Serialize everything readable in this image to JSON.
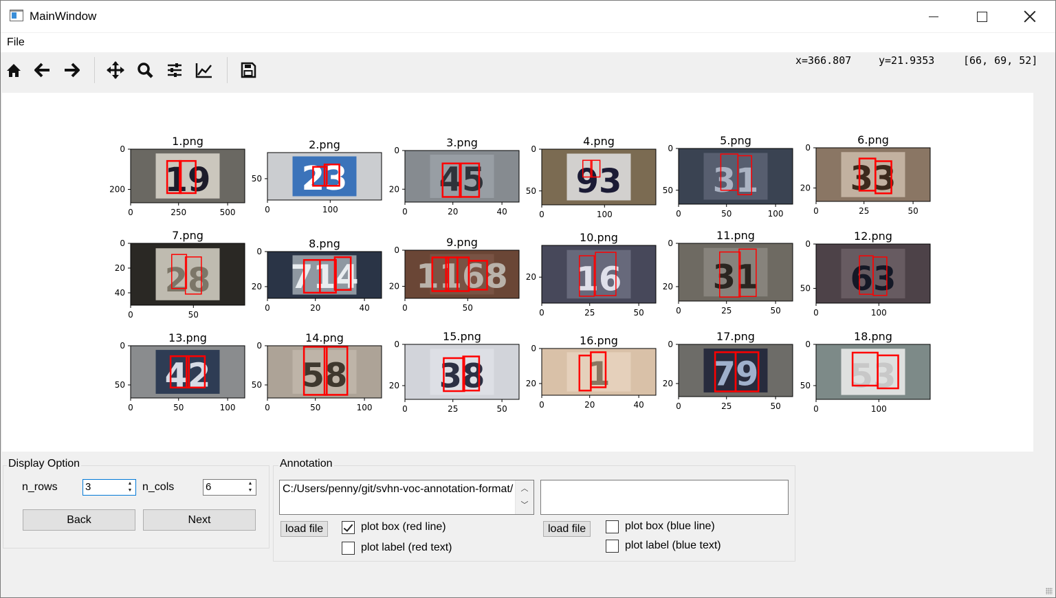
{
  "window": {
    "title": "MainWindow"
  },
  "menu": {
    "file": "File"
  },
  "toolbar": {
    "icons": [
      "home-icon",
      "back-arrow-icon",
      "forward-arrow-icon",
      "pan-icon",
      "zoom-icon",
      "configure-subplots-icon",
      "edit-axis-icon",
      "save-icon"
    ],
    "x": "x=366.807",
    "y": "y=21.9353",
    "pixel": "[66, 69, 52]"
  },
  "figure": {
    "titles": [
      "1.png",
      "2.png",
      "3.png",
      "4.png",
      "5.png",
      "6.png",
      "7.png",
      "8.png",
      "9.png",
      "10.png",
      "11.png",
      "12.png",
      "13.png",
      "14.png",
      "15.png",
      "16.png",
      "17.png",
      "18.png"
    ],
    "images": [
      {
        "digits": "19",
        "bg": "#6a6862",
        "plate": "#d6d2c8",
        "fg": "#1d1c2a"
      },
      {
        "digits": "23",
        "bg": "#cbcdd0",
        "plate": "#2b69b7",
        "fg": "#ffffff"
      },
      {
        "digits": "45",
        "bg": "#868b90",
        "plate": "#9aa0a6",
        "fg": "#2e333a"
      },
      {
        "digits": "93",
        "bg": "#7b6b52",
        "plate": "#dcdcdc",
        "fg": "#1b1b35"
      },
      {
        "digits": "31",
        "bg": "#3a4352",
        "plate": "#5b6272",
        "fg": "#aab2c2"
      },
      {
        "digits": "33",
        "bg": "#8a7664",
        "plate": "#c8b8a6",
        "fg": "#3c2a1c"
      },
      {
        "digits": "28",
        "bg": "#2a2824",
        "plate": "#cfcbc0",
        "fg": "#7c7668"
      },
      {
        "digits": "714",
        "bg": "#2a3446",
        "plate": "#9aa3ab",
        "fg": "#e9edf0"
      },
      {
        "digits": "1168",
        "bg": "#6a4636",
        "plate": "#7b5446",
        "fg": "#b9b2aa"
      },
      {
        "digits": "16",
        "bg": "#47485a",
        "plate": "#6a6d7e",
        "fg": "#dfe0ea"
      },
      {
        "digits": "31",
        "bg": "#6e6a62",
        "plate": "#8a8680",
        "fg": "#2a2620"
      },
      {
        "digits": "63",
        "bg": "#4d4248",
        "plate": "#6a5e64",
        "fg": "#141826"
      },
      {
        "digits": "42",
        "bg": "#8a8c8e",
        "plate": "#23334e",
        "fg": "#d6dbe5"
      },
      {
        "digits": "58",
        "bg": "#ada397",
        "plate": "#c0b6aa",
        "fg": "#3f382e"
      },
      {
        "digits": "38",
        "bg": "#d2d4da",
        "plate": "#dee0e6",
        "fg": "#2c3044"
      },
      {
        "digits": "1",
        "bg": "#d9c1a8",
        "plate": "#e6d2bc",
        "fg": "#8a7660"
      },
      {
        "digits": "79",
        "bg": "#6d6c68",
        "plate": "#1f2538",
        "fg": "#9fb0cc"
      },
      {
        "digits": "53",
        "bg": "#7d8a88",
        "plate": "#e9e9e9",
        "fg": "#c8c8c8"
      }
    ],
    "xticks": [
      [
        "0",
        "250",
        "500"
      ],
      [
        "0",
        "100"
      ],
      [
        "0",
        "20",
        "40"
      ],
      [
        "0",
        "100"
      ],
      [
        "0",
        "50",
        "100"
      ],
      [
        "0",
        "25",
        "50"
      ],
      [
        "0",
        "50"
      ],
      [
        "0",
        "20",
        "40"
      ],
      [
        "0",
        "50"
      ],
      [
        "0",
        "25",
        "50"
      ],
      [
        "0",
        "25",
        "50"
      ],
      [
        "0",
        "100"
      ],
      [
        "0",
        "50",
        "100"
      ],
      [
        "0",
        "50",
        "100"
      ],
      [
        "0",
        "25",
        "50"
      ],
      [
        "0",
        "20",
        "40"
      ],
      [
        "0",
        "25",
        "50"
      ],
      [
        "0",
        "100"
      ]
    ],
    "yticks": [
      [
        "0",
        "200"
      ],
      [
        "50"
      ],
      [
        "0",
        "20"
      ],
      [
        "0",
        "50"
      ],
      [
        "0",
        "50"
      ],
      [
        "0",
        "20"
      ],
      [
        "0",
        "20",
        "40"
      ],
      [
        "0",
        "20"
      ],
      [
        "0",
        "20"
      ],
      [
        "20"
      ],
      [
        "0",
        "20"
      ],
      [
        "0",
        "50"
      ],
      [
        "0",
        "50"
      ],
      [
        "0",
        "50"
      ],
      [
        "0",
        "20"
      ],
      [
        "0",
        "20"
      ],
      [
        "0",
        "20"
      ],
      [
        "0",
        "50"
      ]
    ]
  },
  "display_option": {
    "title": "Display Option",
    "n_rows_label": "n_rows",
    "n_rows_value": "3",
    "n_cols_label": "n_cols",
    "n_cols_value": "6",
    "back": "Back",
    "next": "Next"
  },
  "annotation": {
    "title": "Annotation",
    "path_text": "C:/Users/penny/git/svhn-voc-annotation-format/",
    "load_file": "load file",
    "plot_box_red": "plot box (red line)",
    "plot_label_red": "plot label (red text)",
    "load_file_2": "load file",
    "plot_box_blue": "plot box (blue line)",
    "plot_label_blue": "plot label (blue text)",
    "plot_box_red_checked": true
  }
}
